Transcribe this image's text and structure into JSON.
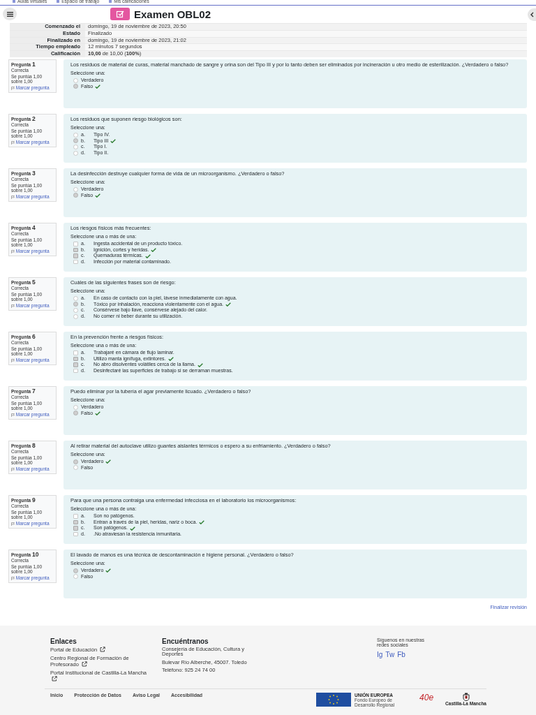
{
  "top_nav": {
    "items": [
      "Aulas virtuales",
      "Espacio de trabajo",
      "Mis calificaciones"
    ]
  },
  "page": {
    "title": "Examen OBL02"
  },
  "summary": [
    {
      "label": "Comenzado el",
      "value": "domingo, 19 de noviembre de 2023, 20:50"
    },
    {
      "label": "Estado",
      "value": "Finalizado"
    },
    {
      "label": "Finalizado en",
      "value": "domingo, 19 de noviembre de 2023, 21:02"
    },
    {
      "label": "Tiempo empleado",
      "value": "12 minutos 7 segundos"
    },
    {
      "label": "Calificación",
      "value": "**10,00** de 10,00 (**100%**)"
    }
  ],
  "questions": [
    {
      "label": "Pregunta",
      "number": "1",
      "state": "Correcta",
      "score": "Se puntúa 1,00 sobre 1,00",
      "flag": "Marcar pregunta",
      "text": "Los residuos de material de curas, material manchado de sangre y orina son del Tipo III y por lo tanto deben ser eliminados por incineración u otro medio de esterilización. ¿Verdadero o falso?",
      "prompt": "Seleccione una:",
      "kind": "single",
      "options": [
        {
          "text": "Verdadero",
          "selected": false,
          "correct": false
        },
        {
          "text": "Falso",
          "selected": true,
          "correct": true
        }
      ]
    },
    {
      "label": "Pregunta",
      "number": "2",
      "state": "Correcta",
      "score": "Se puntúa 1,00 sobre 1,00",
      "flag": "Marcar pregunta",
      "text": "Los residuos que suponen riesgo biológicos son:",
      "prompt": "Seleccione una:",
      "kind": "single",
      "options": [
        {
          "letter": "a.",
          "text": "Tipo IV.",
          "selected": false,
          "correct": false
        },
        {
          "letter": "b.",
          "text": "Tipo III",
          "selected": true,
          "correct": true
        },
        {
          "letter": "c.",
          "text": "Tipo I.",
          "selected": false,
          "correct": false
        },
        {
          "letter": "d.",
          "text": "Tipo II.",
          "selected": false,
          "correct": false
        }
      ]
    },
    {
      "label": "Pregunta",
      "number": "3",
      "state": "Correcta",
      "score": "Se puntúa 1,00 sobre 1,00",
      "flag": "Marcar pregunta",
      "text": "La desinfección destruye cualquier forma de vida de un microorganismo. ¿Verdadero o falso?",
      "prompt": "Seleccione una:",
      "kind": "single",
      "options": [
        {
          "text": "Verdadero",
          "selected": false,
          "correct": false
        },
        {
          "text": "Falso",
          "selected": true,
          "correct": true
        }
      ]
    },
    {
      "label": "Pregunta",
      "number": "4",
      "state": "Correcta",
      "score": "Se puntúa 1,00 sobre 1,00",
      "flag": "Marcar pregunta",
      "text": "Los riesgos físicos más frecuentes:",
      "prompt": "Seleccione una o más de una:",
      "kind": "multiple",
      "options": [
        {
          "letter": "a.",
          "text": "Ingesta accidental de un producto tóxico.",
          "selected": false,
          "correct": false
        },
        {
          "letter": "b.",
          "text": "Ignición, cortes y heridas.",
          "selected": true,
          "correct": true
        },
        {
          "letter": "c.",
          "text": "Quemaduras térmicas.",
          "selected": true,
          "correct": true
        },
        {
          "letter": "d.",
          "text": "Infección por material contaminado.",
          "selected": false,
          "correct": false
        }
      ]
    },
    {
      "label": "Pregunta",
      "number": "5",
      "state": "Correcta",
      "score": "Se puntúa 1,00 sobre 1,00",
      "flag": "Marcar pregunta",
      "text": "Cuáles de las siguientes frases son de riesgo:",
      "prompt": "Seleccione una:",
      "kind": "single",
      "options": [
        {
          "letter": "a.",
          "text": "En caso de contacto con la piel, lávese inmediatamente con agua.",
          "selected": false,
          "correct": false
        },
        {
          "letter": "b.",
          "text": "Tóxico por inhalación, reacciona violentamente con el agua.",
          "selected": true,
          "correct": true
        },
        {
          "letter": "c.",
          "text": "Consérvese bajo llave, consérvese alejado del calor.",
          "selected": false,
          "correct": false
        },
        {
          "letter": "d.",
          "text": "No comer ni beber durante su utilización.",
          "selected": false,
          "correct": false
        }
      ]
    },
    {
      "label": "Pregunta",
      "number": "6",
      "state": "Correcta",
      "score": "Se puntúa 1,00 sobre 1,00",
      "flag": "Marcar pregunta",
      "text": "En la prevención frente a riesgos físicos:",
      "prompt": "Seleccione una o más de una:",
      "kind": "multiple",
      "options": [
        {
          "letter": "a.",
          "text": "Trabajaré en cámara de flujo laminar.",
          "selected": false,
          "correct": false
        },
        {
          "letter": "b.",
          "text": "Utilizo manta ignífuga, extintores.",
          "selected": true,
          "correct": true
        },
        {
          "letter": "c.",
          "text": "No abro disolventes volátiles cerca de la llama.",
          "selected": true,
          "correct": true
        },
        {
          "letter": "d.",
          "text": "Desinfectaré las superficies de trabajo si se derraman muestras.",
          "selected": false,
          "correct": false
        }
      ]
    },
    {
      "label": "Pregunta",
      "number": "7",
      "state": "Correcta",
      "score": "Se puntúa 1,00 sobre 1,00",
      "flag": "Marcar pregunta",
      "text": "Puedo eliminar por la tubería el agar previamente licuado. ¿Verdadero o falso?",
      "prompt": "Seleccione una:",
      "kind": "single",
      "options": [
        {
          "text": "Verdadero",
          "selected": false,
          "correct": false
        },
        {
          "text": "Falso",
          "selected": true,
          "correct": true
        }
      ]
    },
    {
      "label": "Pregunta",
      "number": "8",
      "state": "Correcta",
      "score": "Se puntúa 1,00 sobre 1,00",
      "flag": "Marcar pregunta",
      "text": "Al retirar material del autoclave utilizo guantes aislantes térmicos o espero a su enfriamiento. ¿Verdadero o falso?",
      "prompt": "Seleccione una:",
      "kind": "single",
      "options": [
        {
          "text": "Verdadero",
          "selected": true,
          "correct": true
        },
        {
          "text": "Falso",
          "selected": false,
          "correct": false
        }
      ]
    },
    {
      "label": "Pregunta",
      "number": "9",
      "state": "Correcta",
      "score": "Se puntúa 1,00 sobre 1,00",
      "flag": "Marcar pregunta",
      "text": "Para que una persona contraiga una enfermedad infecciosa en el laboratorio los microorganismos:",
      "prompt": "Seleccione una o más de una:",
      "kind": "multiple",
      "options": [
        {
          "letter": "a.",
          "text": "Son no patógenos.",
          "selected": false,
          "correct": false
        },
        {
          "letter": "b.",
          "text": "Entran a través de la piel, heridas, nariz o boca.",
          "selected": true,
          "correct": true
        },
        {
          "letter": "c.",
          "text": "Son patógenos.",
          "selected": true,
          "correct": true
        },
        {
          "letter": "d.",
          "text": ".No atraviesan la resistencia inmunitaria.",
          "selected": false,
          "correct": false
        }
      ]
    },
    {
      "label": "Pregunta",
      "number": "10",
      "state": "Correcta",
      "score": "Se puntúa 1,00 sobre 1,00",
      "flag": "Marcar pregunta",
      "text": "El lavado de manos es una técnica de descontaminación e higiene personal. ¿Verdadero o falso?",
      "prompt": "Seleccione una:",
      "kind": "single",
      "options": [
        {
          "text": "Verdadero",
          "selected": true,
          "correct": true
        },
        {
          "text": "Falso",
          "selected": false,
          "correct": false
        }
      ]
    }
  ],
  "finish_link": "Finalizar revisión",
  "footer": {
    "links_title": "Enlaces",
    "links": [
      "Portal de Educación",
      "Centro Regional de Formación de Profesorado",
      "Portal Institucional de Castilla-La Mancha"
    ],
    "contact_title": "Encuéntranos",
    "contact": [
      "Consejería de Educación, Cultura y Deportes",
      "Bulevar Río Alberche, 45007. Toledo",
      "Teléfono: 925 24 74 00"
    ],
    "social_title": "Síguenos en nuestras redes sociales",
    "social": [
      "Ig",
      "Tw",
      "Fb"
    ],
    "bottom_links": [
      "Inicio",
      "Protección de Datos",
      "Aviso Legal",
      "Accesibilidad"
    ],
    "eu_title": "UNIÓN EUROPEA",
    "eu_subtitle": "Fondo Europeo de Desarrollo Regional",
    "logo_text": "40e",
    "region": "Castilla-La Mancha"
  }
}
